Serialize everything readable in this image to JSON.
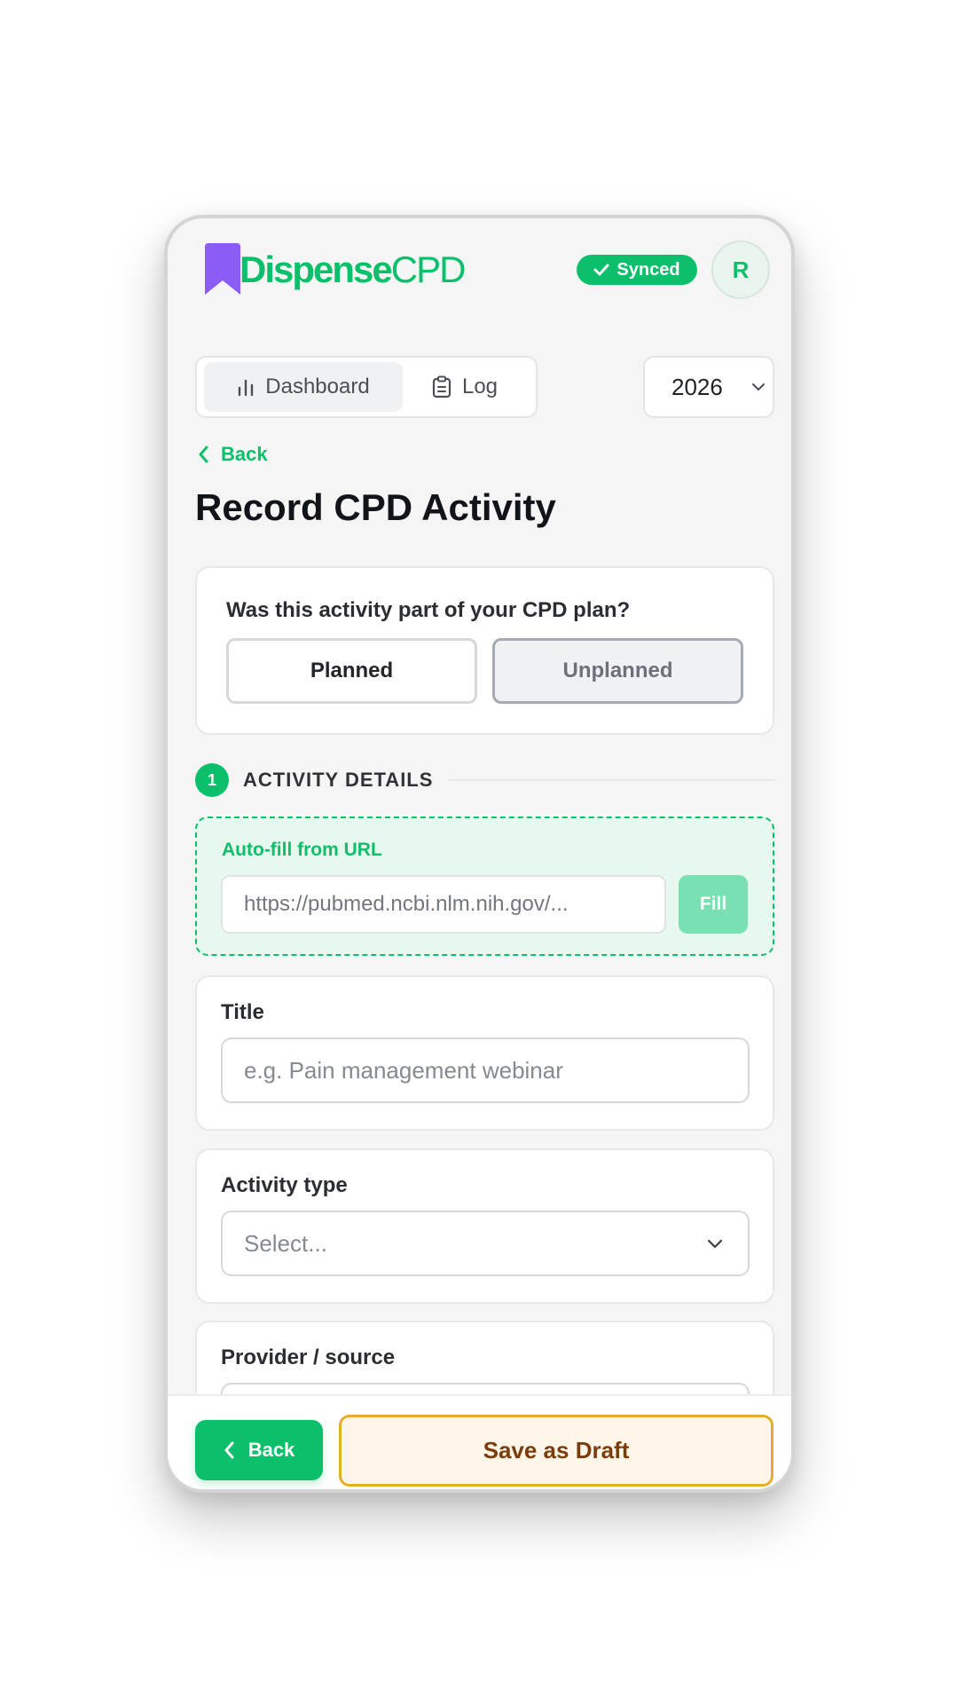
{
  "header": {
    "brand_part1": "Dispense",
    "brand_part2": "CPD",
    "sync_status": "Synced",
    "avatar_initial": "R",
    "brand_color": "#0cbf6a",
    "logo_color": "#8b5cf6"
  },
  "nav": {
    "tabs": [
      {
        "label": "Dashboard",
        "icon": "bar-chart-icon",
        "active": true
      },
      {
        "label": "Log",
        "icon": "clipboard-icon",
        "active": false
      }
    ],
    "year": "2026"
  },
  "page": {
    "back_link": "Back",
    "title": "Record CPD Activity"
  },
  "plan": {
    "question": "Was this activity part of your CPD plan?",
    "options": [
      {
        "label": "Planned",
        "selected": false
      },
      {
        "label": "Unplanned",
        "selected": true
      }
    ]
  },
  "section": {
    "number": "1",
    "title": "ACTIVITY DETAILS"
  },
  "autofill": {
    "label": "Auto-fill from URL",
    "placeholder": "https://pubmed.ncbi.nlm.nih.gov/...",
    "button": "Fill"
  },
  "fields": {
    "title": {
      "label": "Title",
      "placeholder": "e.g. Pain management webinar"
    },
    "activity_type": {
      "label": "Activity type",
      "placeholder": "Select..."
    },
    "provider": {
      "label": "Provider / source"
    }
  },
  "footer": {
    "back": "Back",
    "save_draft": "Save as Draft"
  }
}
